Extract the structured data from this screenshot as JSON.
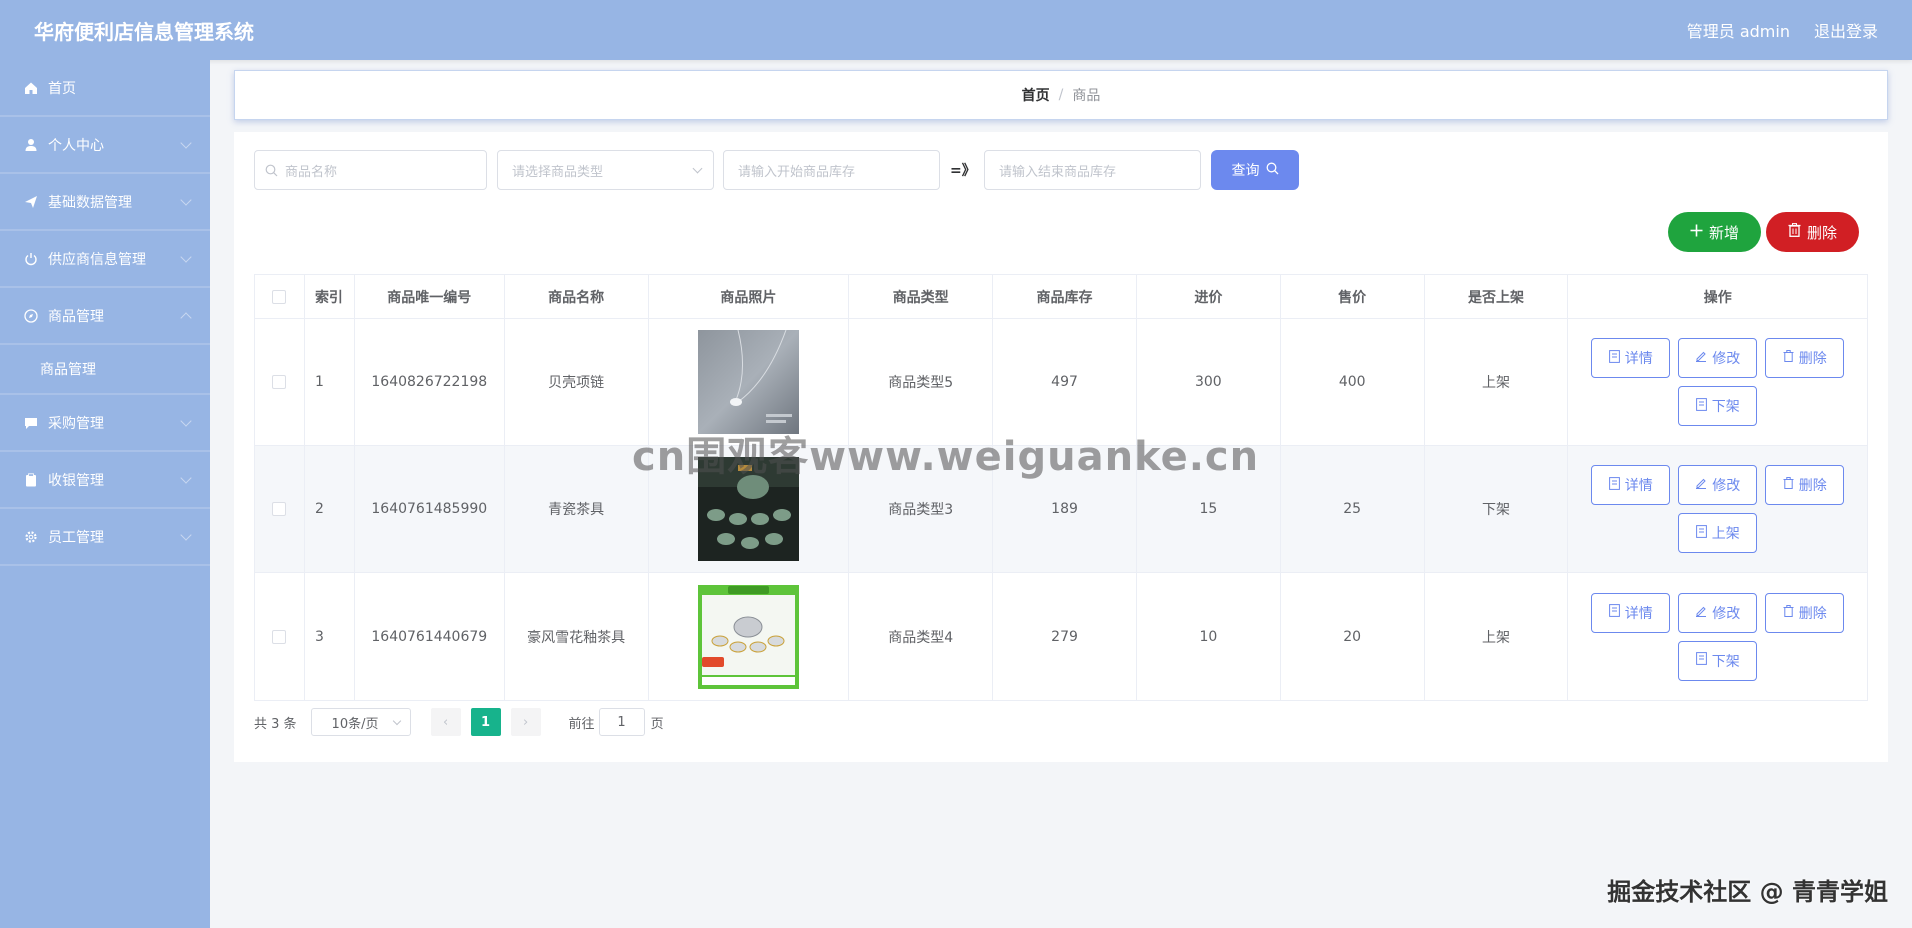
{
  "header": {
    "title": "华府便利店信息管理系统",
    "user": "管理员 admin",
    "logout": "退出登录"
  },
  "sidebar": {
    "items": [
      {
        "label": "首页",
        "icon": "home-icon"
      },
      {
        "label": "个人中心",
        "icon": "user-icon"
      },
      {
        "label": "基础数据管理",
        "icon": "send-icon"
      },
      {
        "label": "供应商信息管理",
        "icon": "power-icon"
      },
      {
        "label": "商品管理",
        "icon": "compass-icon"
      },
      {
        "label": "商品管理",
        "icon": ""
      },
      {
        "label": "采购管理",
        "icon": "chat-icon"
      },
      {
        "label": "收银管理",
        "icon": "clipboard-icon"
      },
      {
        "label": "员工管理",
        "icon": "gear-icon"
      }
    ]
  },
  "breadcrumb": {
    "home": "首页",
    "sep": "/",
    "current": "商品"
  },
  "search": {
    "name_placeholder": "商品名称",
    "type_placeholder": "请选择商品类型",
    "stock_start_placeholder": "请输入开始商品库存",
    "range_sep": "=》",
    "stock_end_placeholder": "请输入结束商品库存",
    "query_label": "查询"
  },
  "toolbar": {
    "add_label": "新增",
    "delete_label": "删除"
  },
  "table": {
    "headers": [
      "",
      "索引",
      "商品唯一编号",
      "商品名称",
      "商品照片",
      "商品类型",
      "商品库存",
      "进价",
      "售价",
      "是否上架",
      "操作"
    ],
    "rows": [
      {
        "index": "1",
        "code": "1640826722198",
        "name": "贝壳项链",
        "type": "商品类型5",
        "stock": "497",
        "cost": "300",
        "price": "400",
        "status": "上架",
        "toggle": "下架",
        "photo": "necklace"
      },
      {
        "index": "2",
        "code": "1640761485990",
        "name": "青瓷茶具",
        "type": "商品类型3",
        "stock": "189",
        "cost": "15",
        "price": "25",
        "status": "下架",
        "toggle": "上架",
        "photo": "teaset-dark"
      },
      {
        "index": "3",
        "code": "1640761440679",
        "name": "豪风雪花釉茶具",
        "type": "商品类型4",
        "stock": "279",
        "cost": "10",
        "price": "20",
        "status": "上架",
        "toggle": "下架",
        "photo": "teaset-green"
      }
    ],
    "ops": {
      "detail": "详情",
      "edit": "修改",
      "delete": "删除"
    }
  },
  "pager": {
    "total": "共 3 条",
    "size": "10条/页",
    "current": "1",
    "goto": "前往",
    "goto_value": "1",
    "page_unit": "页"
  },
  "watermark": {
    "center": "cn围观客www.weiguanke.cn",
    "corner": "掘金技术社区 @ 青青学姐"
  },
  "colors": {
    "accent": "#6c89ee",
    "sidebar": "#97b5e4",
    "add": "#1fa43e",
    "danger": "#d11f24",
    "pager_active": "#17b38c"
  }
}
